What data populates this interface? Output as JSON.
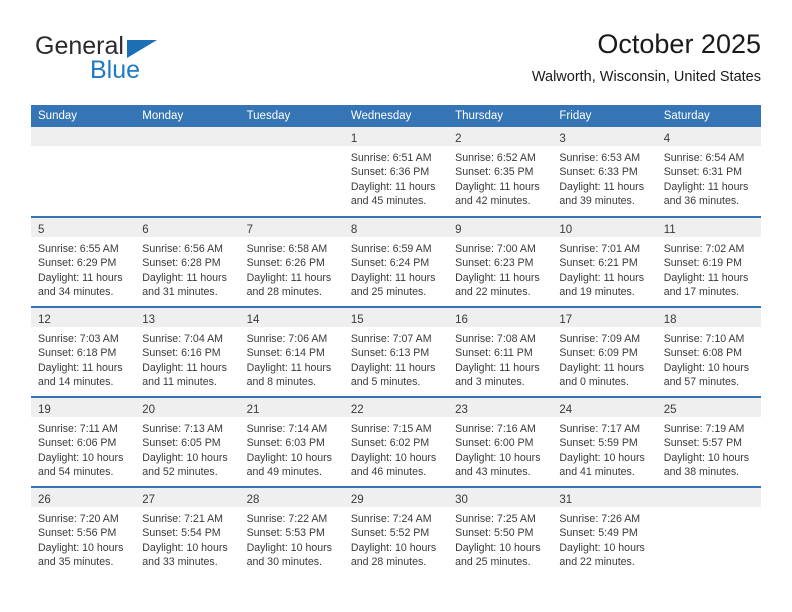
{
  "logo": {
    "word_primary": "General",
    "word_secondary": "Blue",
    "triangle_color": "#1b6fb5",
    "secondary_color": "#1f7ac4"
  },
  "header": {
    "title": "October 2025",
    "subtitle": "Walworth, Wisconsin, United States"
  },
  "theme": {
    "header_blue": "#3575b5",
    "band_gray": "#efefef",
    "text_gray": "#3a3a3a"
  },
  "weekday_headers": [
    "Sunday",
    "Monday",
    "Tuesday",
    "Wednesday",
    "Thursday",
    "Friday",
    "Saturday"
  ],
  "labels": {
    "sunrise_prefix": "Sunrise:",
    "sunset_prefix": "Sunset:",
    "daylight_prefix": "Daylight:"
  },
  "weeks": [
    [
      {
        "day": "",
        "empty": true
      },
      {
        "day": "",
        "empty": true
      },
      {
        "day": "",
        "empty": true
      },
      {
        "day": "1",
        "sunrise": "Sunrise: 6:51 AM",
        "sunset": "Sunset: 6:36 PM",
        "daylight_1": "Daylight: 11 hours",
        "daylight_2": "and 45 minutes."
      },
      {
        "day": "2",
        "sunrise": "Sunrise: 6:52 AM",
        "sunset": "Sunset: 6:35 PM",
        "daylight_1": "Daylight: 11 hours",
        "daylight_2": "and 42 minutes."
      },
      {
        "day": "3",
        "sunrise": "Sunrise: 6:53 AM",
        "sunset": "Sunset: 6:33 PM",
        "daylight_1": "Daylight: 11 hours",
        "daylight_2": "and 39 minutes."
      },
      {
        "day": "4",
        "sunrise": "Sunrise: 6:54 AM",
        "sunset": "Sunset: 6:31 PM",
        "daylight_1": "Daylight: 11 hours",
        "daylight_2": "and 36 minutes."
      }
    ],
    [
      {
        "day": "5",
        "sunrise": "Sunrise: 6:55 AM",
        "sunset": "Sunset: 6:29 PM",
        "daylight_1": "Daylight: 11 hours",
        "daylight_2": "and 34 minutes."
      },
      {
        "day": "6",
        "sunrise": "Sunrise: 6:56 AM",
        "sunset": "Sunset: 6:28 PM",
        "daylight_1": "Daylight: 11 hours",
        "daylight_2": "and 31 minutes."
      },
      {
        "day": "7",
        "sunrise": "Sunrise: 6:58 AM",
        "sunset": "Sunset: 6:26 PM",
        "daylight_1": "Daylight: 11 hours",
        "daylight_2": "and 28 minutes."
      },
      {
        "day": "8",
        "sunrise": "Sunrise: 6:59 AM",
        "sunset": "Sunset: 6:24 PM",
        "daylight_1": "Daylight: 11 hours",
        "daylight_2": "and 25 minutes."
      },
      {
        "day": "9",
        "sunrise": "Sunrise: 7:00 AM",
        "sunset": "Sunset: 6:23 PM",
        "daylight_1": "Daylight: 11 hours",
        "daylight_2": "and 22 minutes."
      },
      {
        "day": "10",
        "sunrise": "Sunrise: 7:01 AM",
        "sunset": "Sunset: 6:21 PM",
        "daylight_1": "Daylight: 11 hours",
        "daylight_2": "and 19 minutes."
      },
      {
        "day": "11",
        "sunrise": "Sunrise: 7:02 AM",
        "sunset": "Sunset: 6:19 PM",
        "daylight_1": "Daylight: 11 hours",
        "daylight_2": "and 17 minutes."
      }
    ],
    [
      {
        "day": "12",
        "sunrise": "Sunrise: 7:03 AM",
        "sunset": "Sunset: 6:18 PM",
        "daylight_1": "Daylight: 11 hours",
        "daylight_2": "and 14 minutes."
      },
      {
        "day": "13",
        "sunrise": "Sunrise: 7:04 AM",
        "sunset": "Sunset: 6:16 PM",
        "daylight_1": "Daylight: 11 hours",
        "daylight_2": "and 11 minutes."
      },
      {
        "day": "14",
        "sunrise": "Sunrise: 7:06 AM",
        "sunset": "Sunset: 6:14 PM",
        "daylight_1": "Daylight: 11 hours",
        "daylight_2": "and 8 minutes."
      },
      {
        "day": "15",
        "sunrise": "Sunrise: 7:07 AM",
        "sunset": "Sunset: 6:13 PM",
        "daylight_1": "Daylight: 11 hours",
        "daylight_2": "and 5 minutes."
      },
      {
        "day": "16",
        "sunrise": "Sunrise: 7:08 AM",
        "sunset": "Sunset: 6:11 PM",
        "daylight_1": "Daylight: 11 hours",
        "daylight_2": "and 3 minutes."
      },
      {
        "day": "17",
        "sunrise": "Sunrise: 7:09 AM",
        "sunset": "Sunset: 6:09 PM",
        "daylight_1": "Daylight: 11 hours",
        "daylight_2": "and 0 minutes."
      },
      {
        "day": "18",
        "sunrise": "Sunrise: 7:10 AM",
        "sunset": "Sunset: 6:08 PM",
        "daylight_1": "Daylight: 10 hours",
        "daylight_2": "and 57 minutes."
      }
    ],
    [
      {
        "day": "19",
        "sunrise": "Sunrise: 7:11 AM",
        "sunset": "Sunset: 6:06 PM",
        "daylight_1": "Daylight: 10 hours",
        "daylight_2": "and 54 minutes."
      },
      {
        "day": "20",
        "sunrise": "Sunrise: 7:13 AM",
        "sunset": "Sunset: 6:05 PM",
        "daylight_1": "Daylight: 10 hours",
        "daylight_2": "and 52 minutes."
      },
      {
        "day": "21",
        "sunrise": "Sunrise: 7:14 AM",
        "sunset": "Sunset: 6:03 PM",
        "daylight_1": "Daylight: 10 hours",
        "daylight_2": "and 49 minutes."
      },
      {
        "day": "22",
        "sunrise": "Sunrise: 7:15 AM",
        "sunset": "Sunset: 6:02 PM",
        "daylight_1": "Daylight: 10 hours",
        "daylight_2": "and 46 minutes."
      },
      {
        "day": "23",
        "sunrise": "Sunrise: 7:16 AM",
        "sunset": "Sunset: 6:00 PM",
        "daylight_1": "Daylight: 10 hours",
        "daylight_2": "and 43 minutes."
      },
      {
        "day": "24",
        "sunrise": "Sunrise: 7:17 AM",
        "sunset": "Sunset: 5:59 PM",
        "daylight_1": "Daylight: 10 hours",
        "daylight_2": "and 41 minutes."
      },
      {
        "day": "25",
        "sunrise": "Sunrise: 7:19 AM",
        "sunset": "Sunset: 5:57 PM",
        "daylight_1": "Daylight: 10 hours",
        "daylight_2": "and 38 minutes."
      }
    ],
    [
      {
        "day": "26",
        "sunrise": "Sunrise: 7:20 AM",
        "sunset": "Sunset: 5:56 PM",
        "daylight_1": "Daylight: 10 hours",
        "daylight_2": "and 35 minutes."
      },
      {
        "day": "27",
        "sunrise": "Sunrise: 7:21 AM",
        "sunset": "Sunset: 5:54 PM",
        "daylight_1": "Daylight: 10 hours",
        "daylight_2": "and 33 minutes."
      },
      {
        "day": "28",
        "sunrise": "Sunrise: 7:22 AM",
        "sunset": "Sunset: 5:53 PM",
        "daylight_1": "Daylight: 10 hours",
        "daylight_2": "and 30 minutes."
      },
      {
        "day": "29",
        "sunrise": "Sunrise: 7:24 AM",
        "sunset": "Sunset: 5:52 PM",
        "daylight_1": "Daylight: 10 hours",
        "daylight_2": "and 28 minutes."
      },
      {
        "day": "30",
        "sunrise": "Sunrise: 7:25 AM",
        "sunset": "Sunset: 5:50 PM",
        "daylight_1": "Daylight: 10 hours",
        "daylight_2": "and 25 minutes."
      },
      {
        "day": "31",
        "sunrise": "Sunrise: 7:26 AM",
        "sunset": "Sunset: 5:49 PM",
        "daylight_1": "Daylight: 10 hours",
        "daylight_2": "and 22 minutes."
      },
      {
        "day": "",
        "empty": true
      }
    ]
  ]
}
